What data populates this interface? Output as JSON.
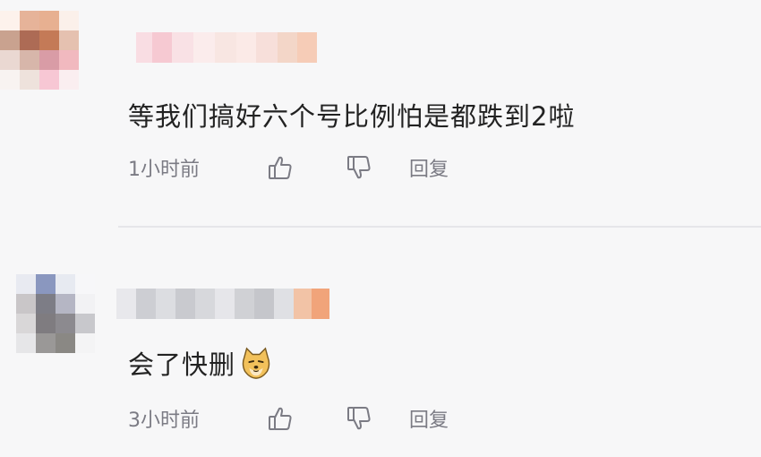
{
  "comments": [
    {
      "text": "等我们搞好六个号比例怕是都跌到2啦",
      "time": "1小时前",
      "reply_label": "回复"
    },
    {
      "text": "会了快删",
      "emoji": "doge-emoji",
      "time": "3小时前",
      "reply_label": "回复"
    }
  ],
  "icons": [
    "thumbs-up-icon",
    "thumbs-down-icon"
  ],
  "colors": {
    "background": "#f7f7f8",
    "text": "#222222",
    "meta": "#7b7b84",
    "divider": "#e6e6e9"
  }
}
